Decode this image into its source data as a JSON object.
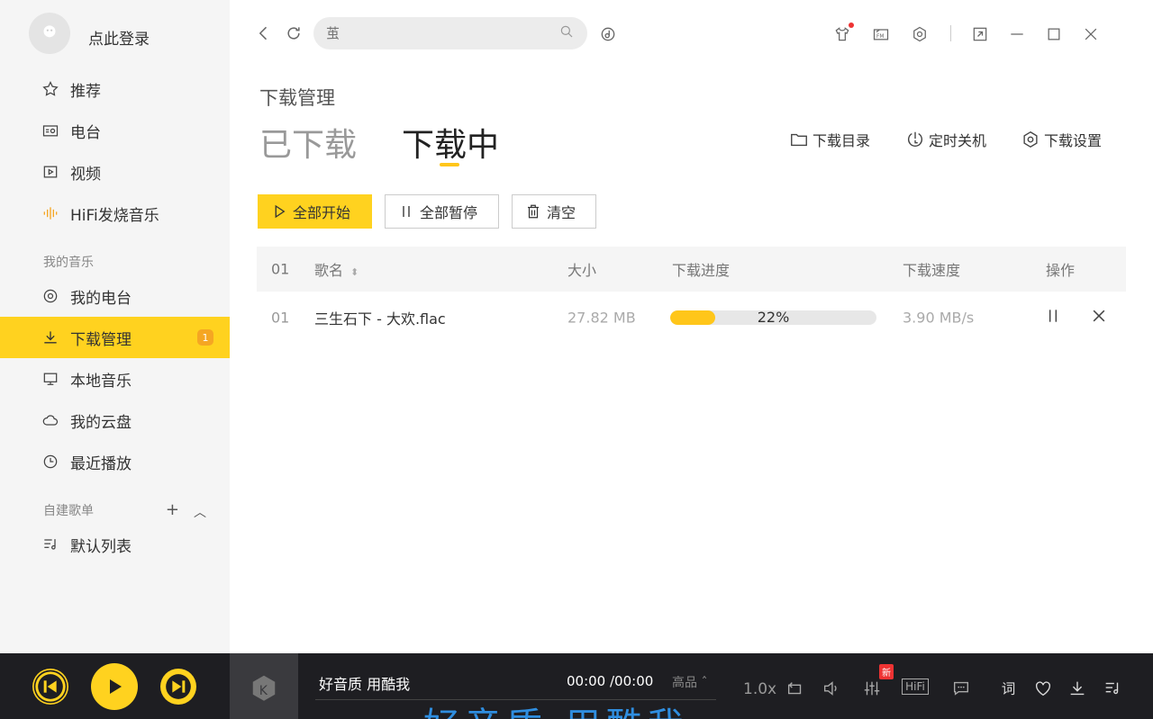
{
  "sidebar": {
    "login_label": "点此登录",
    "items": [
      {
        "label": "推荐"
      },
      {
        "label": "电台"
      },
      {
        "label": "视频"
      },
      {
        "label": "HiFi发烧音乐"
      },
      {
        "label": "我的电台"
      },
      {
        "label": "下载管理",
        "badge": "1"
      },
      {
        "label": "本地音乐"
      },
      {
        "label": "我的云盘"
      },
      {
        "label": "最近播放"
      },
      {
        "label": "默认列表"
      }
    ],
    "section_my_music": "我的音乐",
    "section_playlists": "自建歌单"
  },
  "topbar": {
    "search_placeholder": "茧"
  },
  "main": {
    "page_title": "下载管理",
    "tabs": [
      {
        "label": "已下载"
      },
      {
        "label": "下载中"
      }
    ],
    "tools": {
      "dir": "下载目录",
      "timer": "定时关机",
      "settings": "下载设置"
    },
    "buttons": {
      "start_all": "全部开始",
      "pause_all": "全部暂停",
      "clear": "清空"
    },
    "table": {
      "headers": {
        "index": "01",
        "name": "歌名",
        "size": "大小",
        "progress": "下载进度",
        "speed": "下载速度",
        "ops": "操作"
      },
      "rows": [
        {
          "index": "01",
          "name": "三生石下 - 大欢.flac",
          "size": "27.82 MB",
          "progress_text": "22%",
          "progress_value": 0.22,
          "speed": "3.90 MB/s"
        }
      ]
    }
  },
  "player": {
    "song_title": "好音质 用酷我",
    "time": "00:00 /00:00",
    "quality": "高品 ˆ",
    "lyric": "好音质 用酷我",
    "speed": "1.0x",
    "new_badge": "新",
    "hifi_label": "HiFi"
  },
  "colors": {
    "accent": "#ffd21f",
    "progress": "#ffc61a",
    "player_bg": "#1e1e22",
    "lyric": "#2f8ee0"
  }
}
